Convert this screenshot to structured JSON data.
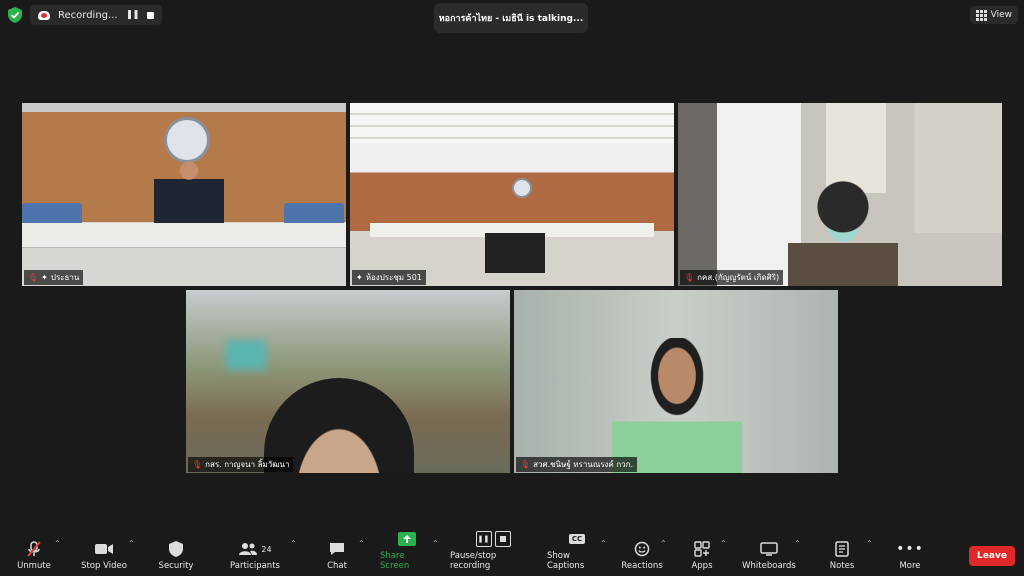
{
  "top": {
    "recording_label": "Recording...",
    "talking": "หอการค้าไทย - เมธินี is talking...",
    "view_label": "View"
  },
  "tiles": [
    {
      "name": "ประธาน"
    },
    {
      "name": "ห้องประชุม 501"
    },
    {
      "name": "กคส.(กัญญรัตน์ เกิดศิริ)"
    },
    {
      "name": "กสร. กาญจนา ลิ้มวัฒนา"
    },
    {
      "name": "สวศ.ชนิษฐ์ ทรานณรงค์ กวก."
    }
  ],
  "toolbar": {
    "unmute": "Unmute",
    "stop_video": "Stop Video",
    "security": "Security",
    "participants": "Participants",
    "participants_count": "24",
    "chat": "Chat",
    "share_screen": "Share Screen",
    "pause_recording": "Pause/stop recording",
    "show_captions": "Show Captions",
    "reactions": "Reactions",
    "apps": "Apps",
    "whiteboards": "Whiteboards",
    "notes": "Notes",
    "more": "More",
    "leave": "Leave"
  },
  "colors": {
    "share_green": "#2bb24c",
    "leave_red": "#e02828",
    "mic_off_red": "#e0423a"
  }
}
